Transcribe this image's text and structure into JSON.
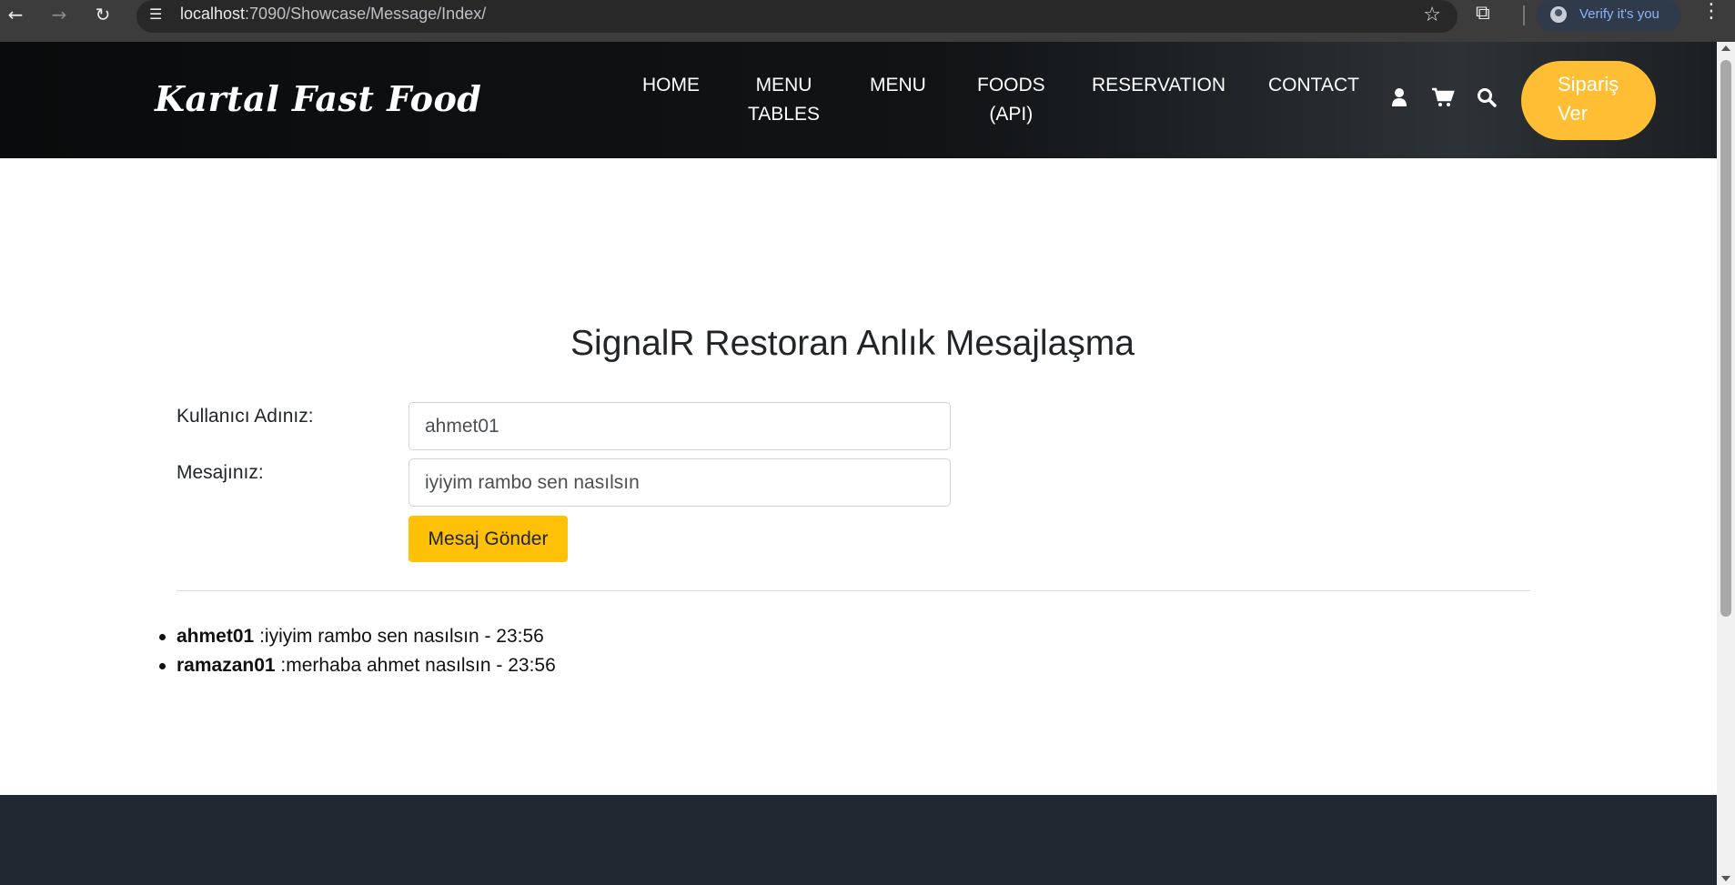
{
  "browser": {
    "url_host": "localhost",
    "url_path": ":7090/Showcase/Message/Index/",
    "verify_text": "Verify it's you"
  },
  "header": {
    "logo": "Kartal Fast Food",
    "nav": [
      {
        "line1": "HOME",
        "line2": ""
      },
      {
        "line1": "MENU",
        "line2": "TABLES"
      },
      {
        "line1": "MENU",
        "line2": ""
      },
      {
        "line1": "FOODS",
        "line2": "(API)"
      },
      {
        "line1": "RESERVATION",
        "line2": ""
      },
      {
        "line1": "CONTACT",
        "line2": ""
      }
    ],
    "order_line1": "Sipariş",
    "order_line2": "Ver"
  },
  "main": {
    "title": "SignalR Restoran Anlık Mesajlaşma",
    "username_label": "Kullanıcı Adınız:",
    "username_value": "ahmet01",
    "message_label": "Mesajınız:",
    "message_value": "iyiyim rambo sen nasılsın",
    "send_label": "Mesaj Gönder",
    "messages": [
      {
        "user": "ahmet01",
        "text": ":iyiyim rambo sen nasılsın - 23:56"
      },
      {
        "user": "ramazan01",
        "text": ":merhaba ahmet nasılsın - 23:56"
      }
    ]
  },
  "colors": {
    "accent": "#ffbe33",
    "button": "#ffc107",
    "footer": "#222831"
  }
}
